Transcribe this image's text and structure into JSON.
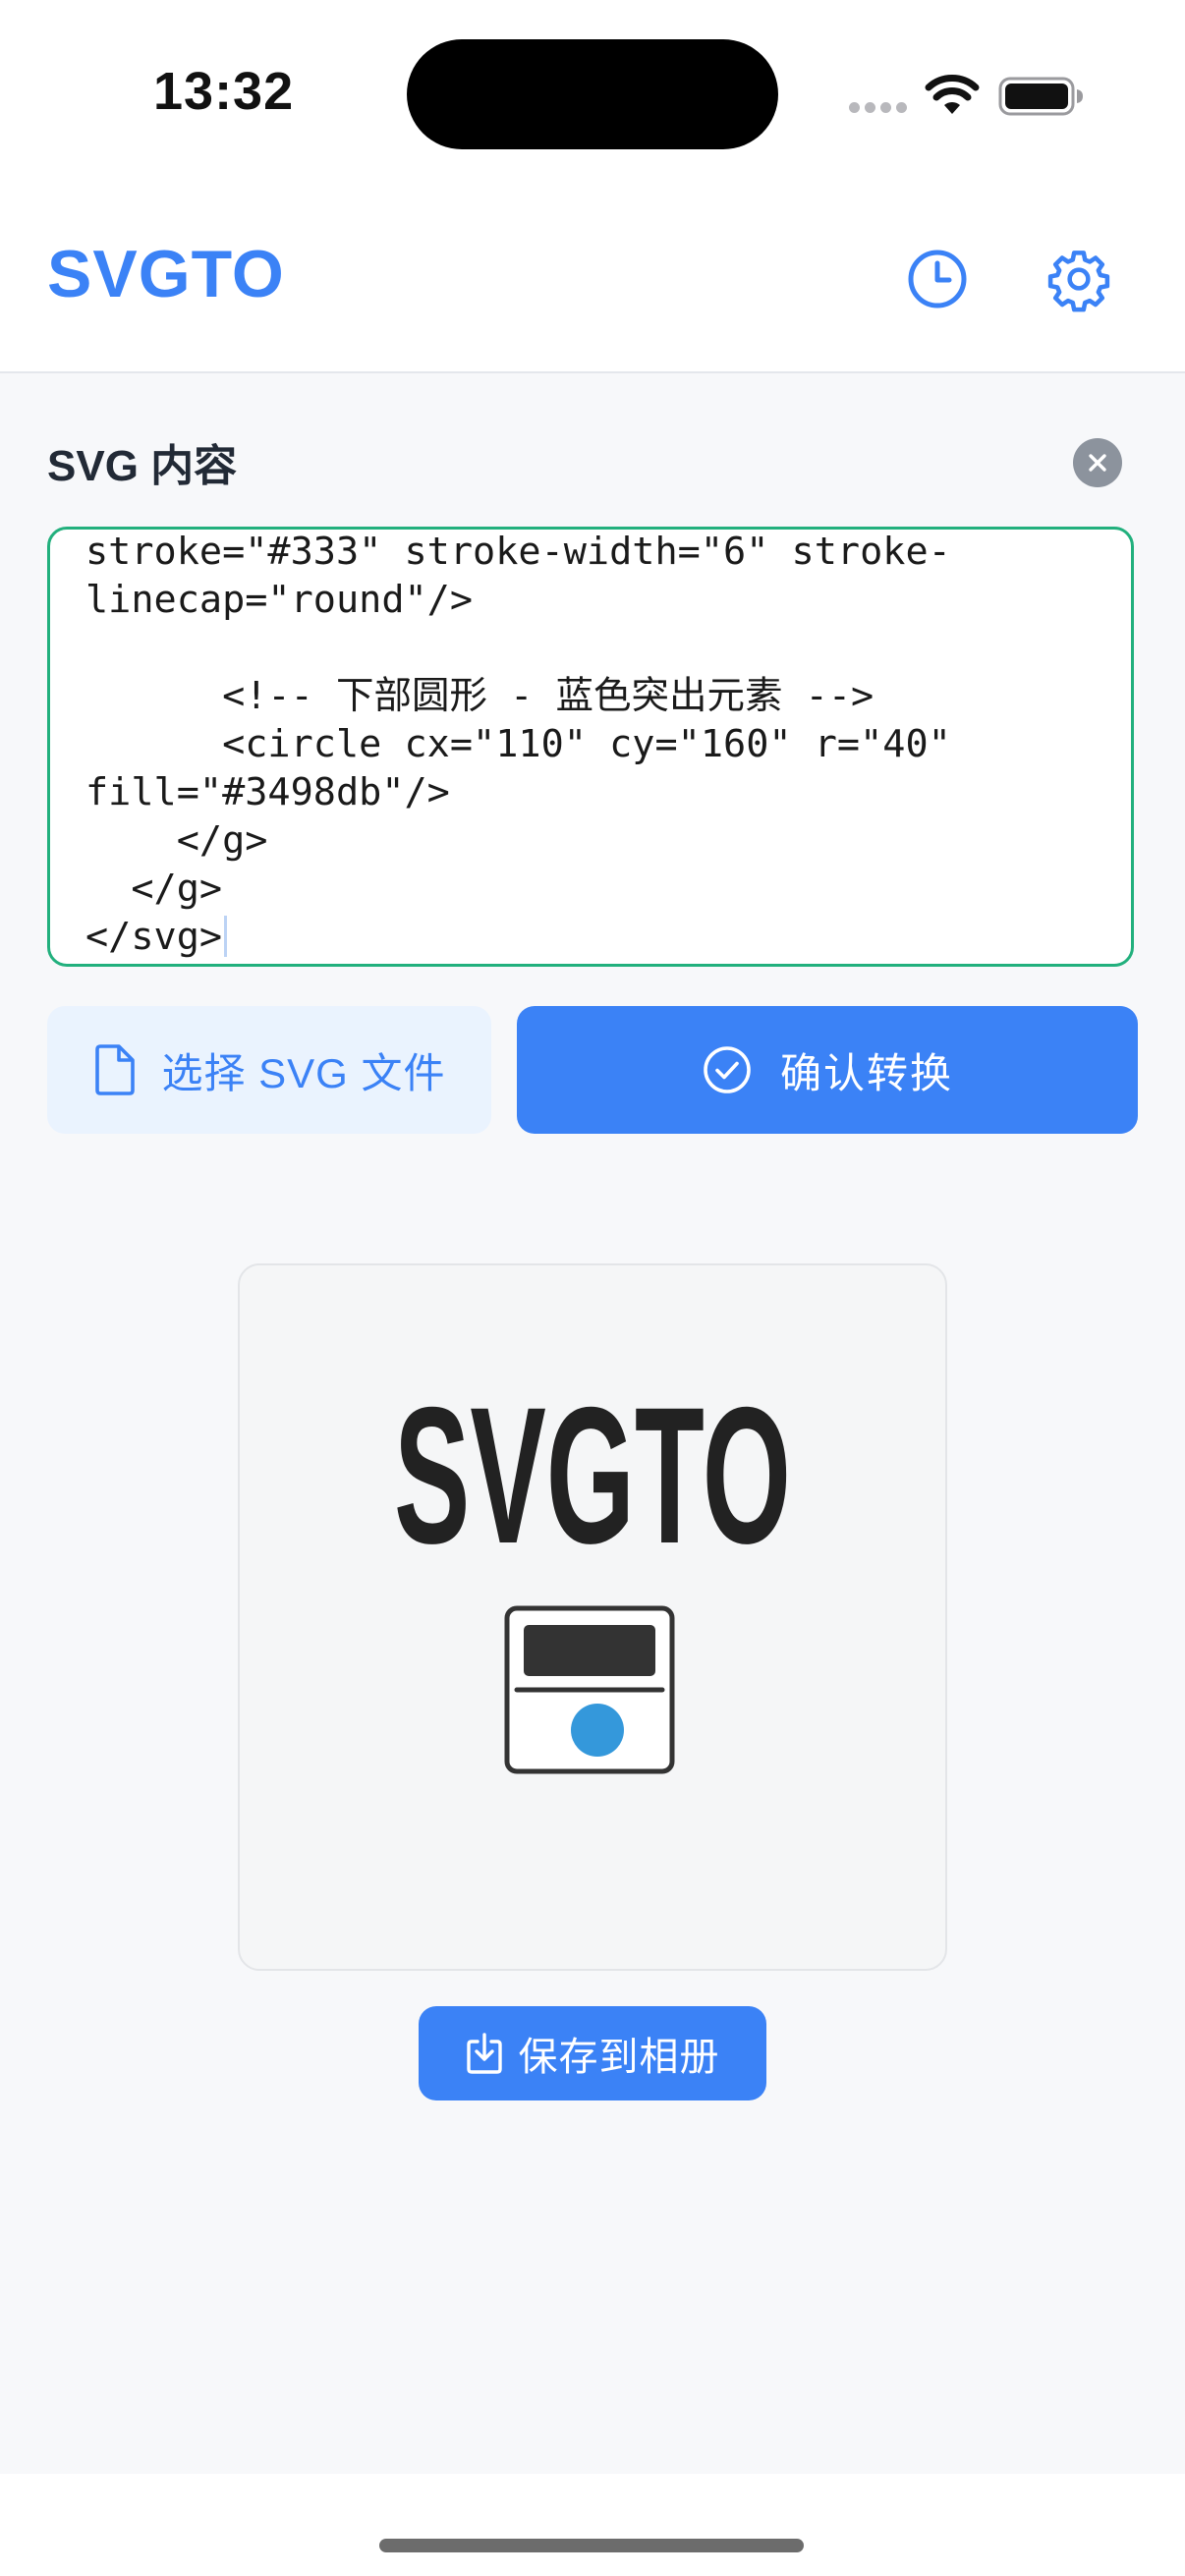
{
  "status_bar": {
    "time": "13:32"
  },
  "header": {
    "title": "SVGTO",
    "history_icon": "clock-icon",
    "settings_icon": "gear-icon"
  },
  "editor": {
    "label": "SVG 内容",
    "clear_icon": "close-circle-icon",
    "code_lines": [
      "stroke=\"#333\" stroke-width=\"6\" stroke-",
      "linecap=\"round\"/>",
      "",
      "      <!-- 下部圆形 - 蓝色突出元素 -->",
      "      <circle cx=\"110\" cy=\"160\" r=\"40\"",
      "fill=\"#3498db\"/>",
      "    </g>",
      "  </g>",
      "</svg>"
    ]
  },
  "actions": {
    "select_file_label": "选择 SVG 文件",
    "select_file_icon": "file-icon",
    "convert_label": "确认转换",
    "convert_icon": "check-circle-icon"
  },
  "preview": {
    "logo_text": "SVGTO",
    "accent_color": "#3498db",
    "stroke_color": "#333333"
  },
  "save": {
    "label": "保存到相册",
    "icon": "download-icon"
  },
  "colors": {
    "primary": "#3b82f6",
    "editor_border": "#22b07d",
    "light_button": "#eaf3fe"
  }
}
